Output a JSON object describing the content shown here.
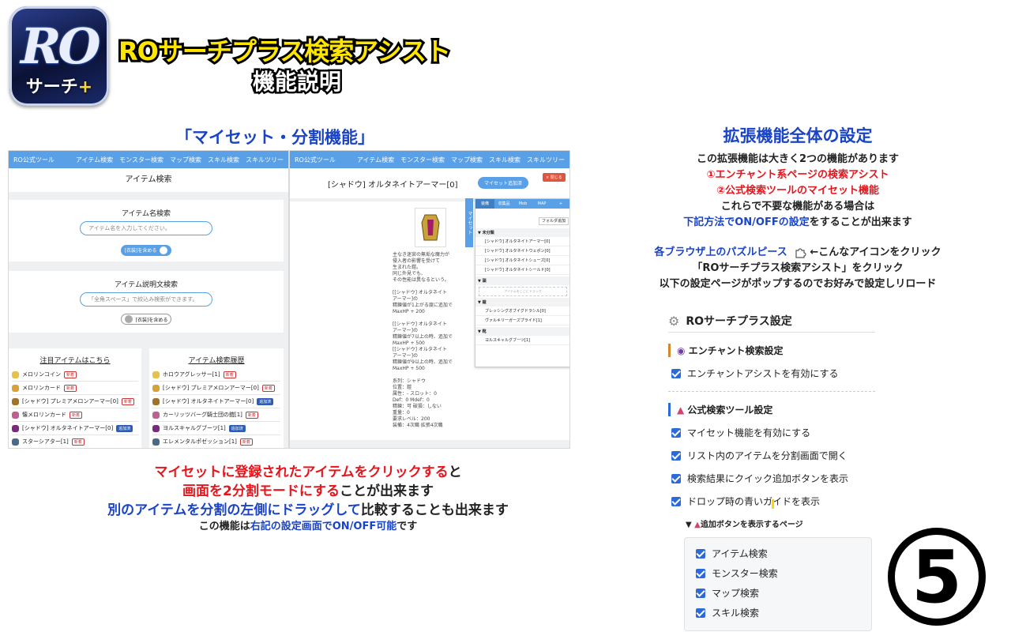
{
  "header": {
    "logo_text": "RO",
    "logo_sub": "サーチ",
    "logo_plus": "+",
    "title": "ROサーチプラス検索アシスト",
    "subtitle": "機能説明"
  },
  "left": {
    "heading": "「マイセット・分割機能」",
    "shot1": {
      "nav": {
        "brand": "RO公式ツール",
        "items": [
          "アイテム検索",
          "モンスター検索",
          "マップ検索",
          "スキル検索",
          "スキルツリー"
        ]
      },
      "page_title": "アイテム検索",
      "name_search": {
        "title": "アイテム名検索",
        "placeholder": "アイテム名を入力してください。",
        "toggle": "[衣装]を含める"
      },
      "desc_search": {
        "title": "アイテム説明文検索",
        "placeholder": "「全角スペース」で絞込み検索ができます。",
        "toggle": "[衣装]を含める"
      },
      "featured": {
        "title": "注目アイテムはこちら",
        "items": [
          {
            "name": "メロリンコイン",
            "tag": "新着"
          },
          {
            "name": "メロリンカード",
            "tag": "新着"
          },
          {
            "name": "[シャドウ] プレミアメロンアーマー[0]",
            "tag": "新着"
          },
          {
            "name": "懐メロリンカード",
            "tag": "新着"
          },
          {
            "name": "[シャドウ] オルタネイトアーマー[0]",
            "tag": "追加済"
          },
          {
            "name": "スターシアター[1]",
            "tag": "新着"
          }
        ]
      },
      "history": {
        "title": "アイテム検索履歴",
        "items": [
          {
            "name": "ホロウアグレッサー[1]",
            "tag": "新着"
          },
          {
            "name": "[シャドウ] プレミアメロンアーマー[0]",
            "tag": "新着"
          },
          {
            "name": "[シャドウ] オルタネイトアーマー[0]",
            "tag": "追加済"
          },
          {
            "name": "カーリッツバーグ騎士団の鎧[1]",
            "tag": "新着"
          },
          {
            "name": "ヨルスキャルグブーツ[1]",
            "tag": "追加済"
          },
          {
            "name": "エレメンタルポゼッション[1]",
            "tag": "新着"
          }
        ]
      }
    },
    "shot2": {
      "nav": {
        "brand": "RO公式ツール",
        "items": [
          "アイテム検索",
          "モンスター検索",
          "マップ検索",
          "スキル検索",
          "スキルツリー"
        ]
      },
      "item_title": "[シャドウ] オルタネイトアーマー[0]",
      "myset_button": "マイセット追加済",
      "close_button": "× 閉じる",
      "desc_lines": [
        "主なき迷宮の無垢な魔力が",
        "侵入者の影響を受けて",
        "生まれた鎧。",
        "同じ外見でも、",
        "その性能は異なるという。",
        "",
        "[[シャドウ] オルタネイト",
        "アーマー]の",
        "精錬値が1上がる度に追加で",
        "MaxHP + 200",
        "",
        "[[シャドウ] オルタネイト",
        "アーマー]の",
        "精錬値が7以上の時、追加で",
        "MaxHP + 500",
        "[[シャドウ] オルタネイト",
        "アーマー]の",
        "精錬値が9以上の時、追加で",
        "MaxHP + 500",
        "",
        "系列：シャドウ",
        "位置：鎧",
        "属性：- スロット：0",
        "Def：0 Mdef：0",
        "精錬：可 破損：しない",
        "重量：0",
        "要求レベル：200",
        "装備：4次職 拡張4次職"
      ],
      "panel": {
        "side_label": "マイセット",
        "tabs": [
          "装備",
          "収集品",
          "Mob",
          "MAP",
          "+"
        ],
        "folder_button": "フォルダ追加",
        "sections": [
          {
            "title": "▼ 未分類",
            "items": [
              "[シャドウ] オルタネイトアーマー[0]",
              "[シャドウ] オルタネイトウェポン[0]",
              "[シャドウ] オルタネイトシューズ[0]",
              "[シャドウ] オルタネイトシールド[0]"
            ]
          },
          {
            "title": "▼ 頭",
            "items": [],
            "empty": "アイテムをここにドラッグ"
          },
          {
            "title": "▼ 鎧",
            "items": [
              "ブレッシングオブイグドラシル[0]",
              "ヴァルキリーガーズプライド[1]"
            ]
          },
          {
            "title": "▼ 靴",
            "items": [
              "ヨルスキャルグブーツ[1]"
            ]
          }
        ]
      }
    },
    "caption": {
      "l1a": "マイセットに登録されたアイテムをクリックする",
      "l1b": "と",
      "l2a": "画面を2分割モードにする",
      "l2b": "ことが出来ます",
      "l3a": "別のアイテムを分割の左側にドラッグして",
      "l3b": "比較することも出来ます",
      "l4a": "この機能は",
      "l4b": "右記の設定画面でON/OFF可能",
      "l4c": "です"
    }
  },
  "right": {
    "heading": "拡張機能全体の設定",
    "intro": "この拡張機能は大きく2つの機能があります",
    "feature1": "①エンチャント系ページの検索アシスト",
    "feature2": "②公式検索ツールのマイセット機能",
    "note1": "これらで不要な機能がある場合は",
    "note2a": "下記方法でON/OFFの設定",
    "note2b": "をすることが出来ます",
    "howto1a": "各ブラウザ上のパズルピース",
    "howto1b": "←こんなアイコンをクリック",
    "howto2": "「ROサーチプラス検索アシスト」をクリック",
    "howto3": "以下の設定ページがポップするのでお好みで設定しリロード",
    "settings": {
      "title": "ROサーチプラス設定",
      "enchant_section": "エンチャント検索設定",
      "enchant_assist": "エンチャントアシストを有効にする",
      "official_section": "公式検索ツール設定",
      "options": [
        "マイセット機能を有効にする",
        "リスト内のアイテムを分割画面で開く",
        "検索結果にクイック追加ボタンを表示",
        "ドロップ時の青いガイドを表示"
      ],
      "pages_label": "追加ボタンを表示するページ",
      "pages": [
        "アイテム検索",
        "モンスター検索",
        "マップ検索",
        "スキル検索"
      ]
    },
    "step_number": "5"
  },
  "colors": {
    "red": "#e8141b",
    "blue": "#1a44c7",
    "nav": "#5aa0e6",
    "yellow": "#ffe600"
  }
}
